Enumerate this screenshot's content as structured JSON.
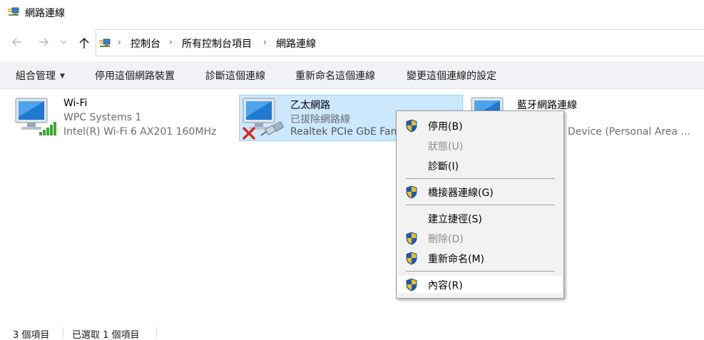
{
  "window": {
    "title": "網路連線",
    "icon": "network-connections-icon"
  },
  "nav": {
    "back_icon": "arrow-left-icon",
    "forward_icon": "arrow-right-icon",
    "recent_icon": "chevron-down-icon",
    "up_icon": "arrow-up-icon"
  },
  "breadcrumb": {
    "items": [
      "控制台",
      "所有控制台項目",
      "網路連線"
    ],
    "separator": "›"
  },
  "toolbar": {
    "organize_label": "組合管理",
    "disable_label": "停用這個網路裝置",
    "diagnose_label": "診斷這個連線",
    "rename_label": "重新命名這個連線",
    "change_settings_label": "變更這個連線的設定"
  },
  "connections": [
    {
      "name": "Wi-Fi",
      "line2": "WPC Systems 1",
      "line3": "Intel(R) Wi-Fi 6 AX201 160MHz",
      "status_icon": "signal-bars-icon"
    },
    {
      "name": "乙太網路",
      "line2": "已拔除網路線",
      "line3": "Realtek PCIe GbE Fam",
      "status_icon": "unplugged-cable-icon",
      "selected": true
    },
    {
      "name": "藍牙網路連線",
      "line3": "Device (Personal Area ..."
    }
  ],
  "context_menu": {
    "items": [
      {
        "label": "停用(B)",
        "shield": true,
        "disabled": false
      },
      {
        "label": "狀態(U)",
        "shield": false,
        "disabled": true
      },
      {
        "label": "診斷(I)",
        "shield": false,
        "disabled": false
      },
      {
        "label": "橋接器連線(G)",
        "shield": true,
        "disabled": false
      },
      {
        "label": "建立捷徑(S)",
        "shield": false,
        "disabled": false
      },
      {
        "label": "刪除(D)",
        "shield": true,
        "disabled": true
      },
      {
        "label": "重新命名(M)",
        "shield": true,
        "disabled": false
      },
      {
        "label": "內容(R)",
        "shield": true,
        "disabled": false,
        "highlighted": true
      }
    ]
  },
  "status_bar": {
    "item_count": "3 個項目",
    "selected_count": "已選取 1 個項目"
  },
  "colors": {
    "selection_fill": "#cce8ff",
    "selection_border": "#99d1ff",
    "command_bar": "#f0f2f5",
    "menu_bg": "#f2f2f2",
    "shield_blue": "#1e5bb8",
    "shield_yellow": "#f2c21b",
    "error_red": "#d6281e"
  }
}
